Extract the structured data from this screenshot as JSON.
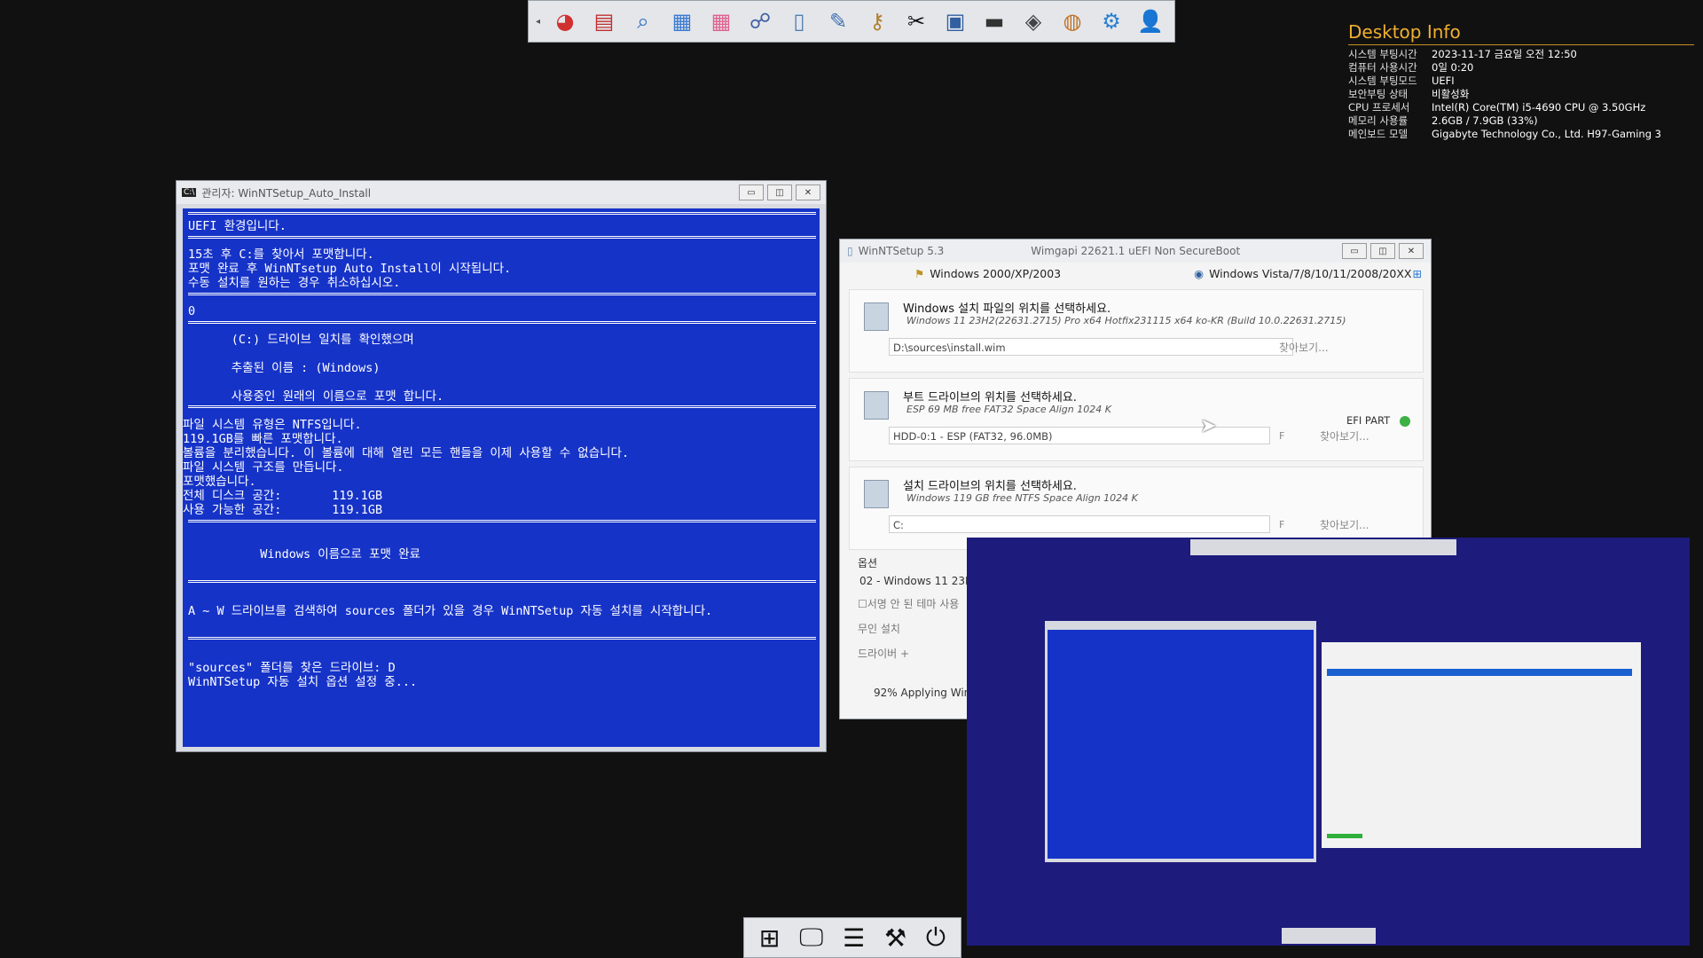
{
  "top_toolbar": {
    "icons": [
      "partition-icon",
      "disk-tool-icon",
      "search-icon",
      "windows-tiles-icon",
      "app-store-icon",
      "network-icon",
      "notepad-icon",
      "tools-icon",
      "keys-icon",
      "repair-icon",
      "user-folder-icon",
      "drive-icon",
      "diamond-icon",
      "backup-icon",
      "settings-gear-icon",
      "add-user-icon"
    ]
  },
  "desktop_info": {
    "title": "Desktop Info",
    "rows": [
      {
        "k": "시스템 부팅시간",
        "v": "2023-11-17 금요일 오전 12:50"
      },
      {
        "k": "컴퓨터 사용시간",
        "v": "0일 0:20"
      },
      {
        "k": "시스템 부팅모드",
        "v": "UEFI"
      },
      {
        "k": "보안부팅 상태",
        "v": "비활성화"
      },
      {
        "k": "CPU 프로세서",
        "v": "Intel(R) Core(TM) i5-4690 CPU @ 3.50GHz"
      },
      {
        "k": "메모리 사용률",
        "v": "2.6GB / 7.9GB (33%)"
      },
      {
        "k": "메인보드 모델",
        "v": "Gigabyte Technology Co., Ltd. H97-Gaming 3"
      }
    ]
  },
  "console": {
    "title": "관리자:  WinNTSetup_Auto_Install",
    "lines": [
      "UEFI 환경입니다.",
      "15초 후 C:를 찾아서 포맷합니다.",
      "포맷 완료 후 WinNTsetup Auto Install이 시작됩니다.",
      "수동 설치를 원하는 경우 취소하십시오.",
      "0",
      "      (C:) 드라이브 일치를 확인했으며",
      "      추출된 이름 : (Windows)",
      "      사용중인 원래의 이름으로 포맷 합니다.",
      "파일 시스템 유형은 NTFS입니다.",
      "119.1GB를 빠른 포맷합니다.",
      "볼륨을 분리했습니다. 이 볼륨에 대해 열린 모든 핸들을 이제 사용할 수 없습니다.",
      "파일 시스템 구조를 만듭니다.",
      "포맷했습니다.",
      "전체 디스크 공간:       119.1GB",
      "사용 가능한 공간:       119.1GB",
      "          Windows 이름으로 포맷 완료",
      "A ~ W 드라이브를 검색하여 sources 폴더가 있을 경우 WinNTSetup 자동 설치를 시작합니다.",
      "\"sources\" 폴더를 찾은 드라이브: D",
      "WinNTSetup 자동 설치 옵션 설정 중..."
    ]
  },
  "setup": {
    "title": "WinNTSetup 5.3",
    "title_mid": "Wimgapi 22621.1   uEFI Non SecureBoot",
    "tab_legacy": "Windows 2000/XP/2003",
    "tab_modern": "Windows Vista/7/8/10/11/2008/20XX",
    "sec1_title": "Windows 설치 파일의 위치를 선택하세요.",
    "sec1_sub": "Windows 11 23H2(22631.2715) Pro x64 Hotfix231115  x64 ko-KR (Build 10.0.22631.2715)",
    "sec1_value": "D:\\sources\\install.wim",
    "sec2_title": "부트 드라이브의 위치를 선택하세요.",
    "sec2_sub": "ESP 69 MB free FAT32 Space Align 1024 K",
    "sec2_value": "HDD-0:1 -  ESP (FAT32, 96.0MB)",
    "sec2_badge": "EFI PART",
    "sec3_title": "설치 드라이브의 위치를 선택하세요.",
    "sec3_sub": "Windows 119 GB free NTFS Space Align 1024 K",
    "sec3_value": "C:",
    "browse": "찾아보기...",
    "drive_letter": "F",
    "options_label": "옵션",
    "edition": "02 - Windows 11 23H",
    "unsigned_theme": "서명 안 된 테마 사용",
    "unattended": "무인 설치",
    "drivers": "드라이버 +",
    "progress": "92% Applying Wind"
  },
  "bottom_toolbar": {
    "icons": [
      "windows-logo-icon",
      "monitor-icon",
      "tasklist-icon",
      "hammer-icon",
      "power-icon"
    ]
  }
}
